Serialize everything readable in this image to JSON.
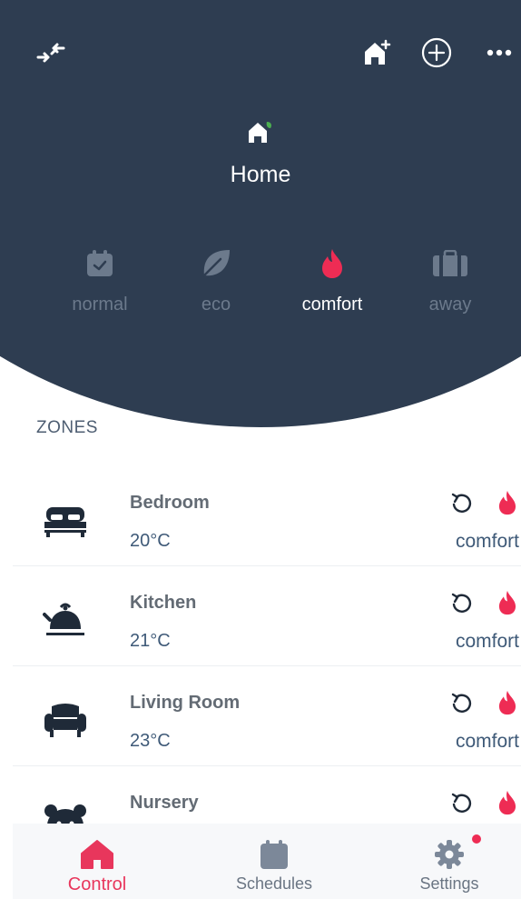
{
  "header": {
    "title": "Home",
    "icons": [
      "collapse-arrows-icon",
      "add-home-icon",
      "add-circle-icon",
      "more-dots-icon",
      "home-leaf-icon"
    ]
  },
  "modes": [
    {
      "label": "normal",
      "icon": "calendar-check-icon",
      "active": false
    },
    {
      "label": "eco",
      "icon": "leaf-icon",
      "active": false
    },
    {
      "label": "comfort",
      "icon": "flame-icon",
      "active": true
    },
    {
      "label": "away",
      "icon": "suitcase-icon",
      "active": false
    }
  ],
  "zones_label": "ZONES",
  "zones": [
    {
      "name": "Bedroom",
      "temp": "20°C",
      "mode": "comfort",
      "icon": "bed-icon"
    },
    {
      "name": "Kitchen",
      "temp": "21°C",
      "mode": "comfort",
      "icon": "kettle-icon"
    },
    {
      "name": "Living Room",
      "temp": "23°C",
      "mode": "comfort",
      "icon": "armchair-icon"
    },
    {
      "name": "Nursery",
      "temp": "",
      "mode": "",
      "icon": "bear-icon"
    }
  ],
  "nav": {
    "control": "Control",
    "schedules": "Schedules",
    "settings": "Settings"
  },
  "colors": {
    "header_bg": "#2e3d51",
    "accent": "#e8365c",
    "text_blue": "#3f5a78"
  }
}
